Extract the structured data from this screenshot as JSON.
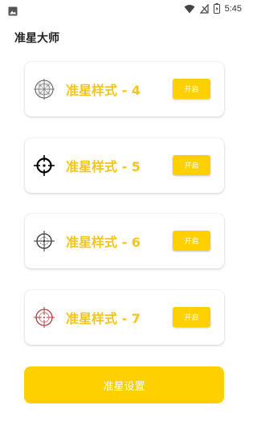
{
  "status_bar": {
    "time": "5:45",
    "icons": [
      "image-icon",
      "wifi-icon",
      "signal-icon",
      "battery-icon"
    ]
  },
  "app": {
    "title": "准星大师"
  },
  "crosshairs": [
    {
      "label": "准星样式 - 4",
      "button": "开启",
      "icon": "crosshair-grid-icon",
      "color": "#555555"
    },
    {
      "label": "准星样式 - 5",
      "button": "开启",
      "icon": "crosshair-bold-icon",
      "color": "#000000"
    },
    {
      "label": "准星样式 - 6",
      "button": "开启",
      "icon": "crosshair-dotted-icon",
      "color": "#333333"
    },
    {
      "label": "准星样式 - 7",
      "button": "开启",
      "icon": "crosshair-red-icon",
      "color": "#b23a3a"
    }
  ],
  "settings_button": {
    "label": "准星设置"
  },
  "colors": {
    "accent": "#ffd000",
    "label_text": "#f5c518"
  }
}
